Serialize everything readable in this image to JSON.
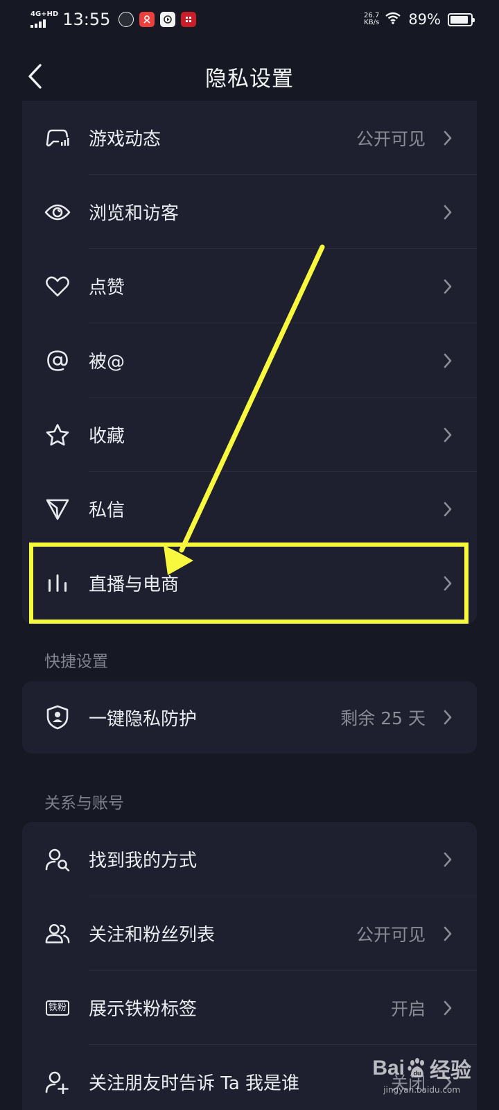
{
  "status_bar": {
    "network": "4G+HD",
    "time": "13:55",
    "net_speed_value": "26.7",
    "net_speed_unit": "KB/s",
    "battery_percent": "89%",
    "battery_level": 0.89
  },
  "header": {
    "title": "隐私设置"
  },
  "group_main": {
    "items": [
      {
        "label": "游戏动态",
        "value": "公开可见",
        "icon": "game-icon"
      },
      {
        "label": "浏览和访客",
        "value": "",
        "icon": "eye-icon"
      },
      {
        "label": "点赞",
        "value": "",
        "icon": "heart-icon"
      },
      {
        "label": "被@",
        "value": "",
        "icon": "at-icon"
      },
      {
        "label": "收藏",
        "value": "",
        "icon": "star-icon"
      },
      {
        "label": "私信",
        "value": "",
        "icon": "send-icon"
      },
      {
        "label": "直播与电商",
        "value": "",
        "icon": "live-bars-icon"
      }
    ]
  },
  "quick_settings": {
    "title": "快捷设置",
    "items": [
      {
        "label": "一键隐私防护",
        "value": "剩余 25 天",
        "icon": "shield-user-icon"
      }
    ]
  },
  "relations": {
    "title": "关系与账号",
    "items": [
      {
        "label": "找到我的方式",
        "value": "",
        "icon": "user-search-icon"
      },
      {
        "label": "关注和粉丝列表",
        "value": "公开可见",
        "icon": "users-icon"
      },
      {
        "label": "展示铁粉标签",
        "value": "开启",
        "icon": "fan-badge-icon",
        "badge_text": "铁粉"
      },
      {
        "label": "关注朋友时告诉 Ta 我是谁",
        "value": "关闭",
        "icon": "user-add-icon"
      }
    ]
  },
  "watermark": {
    "brand_left": "Bai",
    "brand_right": "经验",
    "url": "jingyan.baidu.com"
  },
  "colors": {
    "background": "#161824",
    "card": "#1e2030",
    "annotation": "#f8f93f"
  }
}
